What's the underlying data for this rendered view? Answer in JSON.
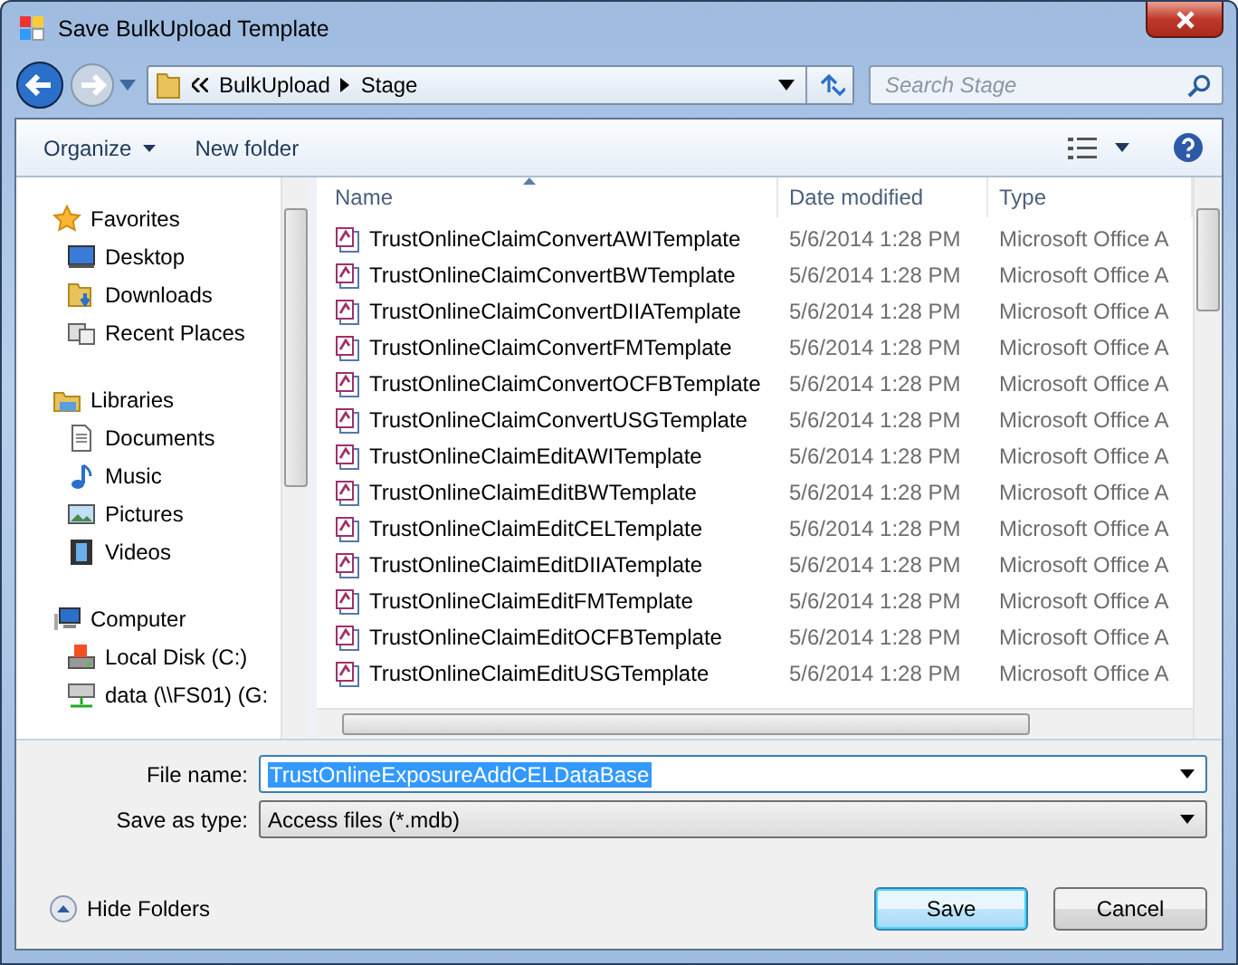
{
  "window": {
    "title": "Save BulkUpload Template"
  },
  "address": {
    "path": [
      "BulkUpload",
      "Stage"
    ]
  },
  "search": {
    "placeholder": "Search Stage"
  },
  "toolbar": {
    "organize": "Organize",
    "new_folder": "New folder"
  },
  "sidebar": {
    "groups": [
      {
        "label": "Favorites",
        "kind": "star",
        "children": [
          {
            "label": "Desktop",
            "kind": "desktop"
          },
          {
            "label": "Downloads",
            "kind": "downloads"
          },
          {
            "label": "Recent Places",
            "kind": "recent"
          }
        ]
      },
      {
        "label": "Libraries",
        "kind": "library",
        "children": [
          {
            "label": "Documents",
            "kind": "document"
          },
          {
            "label": "Music",
            "kind": "music"
          },
          {
            "label": "Pictures",
            "kind": "pictures"
          },
          {
            "label": "Videos",
            "kind": "videos"
          }
        ]
      },
      {
        "label": "Computer",
        "kind": "computer",
        "children": [
          {
            "label": "Local Disk (C:)",
            "kind": "disk"
          },
          {
            "label": "data (\\\\FS01) (G:",
            "kind": "network"
          }
        ]
      }
    ]
  },
  "file_list": {
    "columns": [
      {
        "label": "Name",
        "sorted": true
      },
      {
        "label": "Date modified",
        "sorted": false
      },
      {
        "label": "Type",
        "sorted": false
      }
    ],
    "rows": [
      {
        "name": "TrustOnlineClaimConvertAWITemplate",
        "date": "5/6/2014 1:28 PM",
        "type": "Microsoft Office A"
      },
      {
        "name": "TrustOnlineClaimConvertBWTemplate",
        "date": "5/6/2014 1:28 PM",
        "type": "Microsoft Office A"
      },
      {
        "name": "TrustOnlineClaimConvertDIIATemplate",
        "date": "5/6/2014 1:28 PM",
        "type": "Microsoft Office A"
      },
      {
        "name": "TrustOnlineClaimConvertFMTemplate",
        "date": "5/6/2014 1:28 PM",
        "type": "Microsoft Office A"
      },
      {
        "name": "TrustOnlineClaimConvertOCFBTemplate",
        "date": "5/6/2014 1:28 PM",
        "type": "Microsoft Office A"
      },
      {
        "name": "TrustOnlineClaimConvertUSGTemplate",
        "date": "5/6/2014 1:28 PM",
        "type": "Microsoft Office A"
      },
      {
        "name": "TrustOnlineClaimEditAWITemplate",
        "date": "5/6/2014 1:28 PM",
        "type": "Microsoft Office A"
      },
      {
        "name": "TrustOnlineClaimEditBWTemplate",
        "date": "5/6/2014 1:28 PM",
        "type": "Microsoft Office A"
      },
      {
        "name": "TrustOnlineClaimEditCELTemplate",
        "date": "5/6/2014 1:28 PM",
        "type": "Microsoft Office A"
      },
      {
        "name": "TrustOnlineClaimEditDIIATemplate",
        "date": "5/6/2014 1:28 PM",
        "type": "Microsoft Office A"
      },
      {
        "name": "TrustOnlineClaimEditFMTemplate",
        "date": "5/6/2014 1:28 PM",
        "type": "Microsoft Office A"
      },
      {
        "name": "TrustOnlineClaimEditOCFBTemplate",
        "date": "5/6/2014 1:28 PM",
        "type": "Microsoft Office A"
      },
      {
        "name": "TrustOnlineClaimEditUSGTemplate",
        "date": "5/6/2014 1:28 PM",
        "type": "Microsoft Office A"
      }
    ]
  },
  "form": {
    "file_name_label": "File name:",
    "file_name": "TrustOnlineExposureAddCELDataBase",
    "save_type_label": "Save as type:",
    "save_type": "Access files (*.mdb)"
  },
  "hide_folders": "Hide Folders",
  "buttons": [
    {
      "label": "Save",
      "default": true
    },
    {
      "label": "Cancel",
      "default": false
    }
  ]
}
